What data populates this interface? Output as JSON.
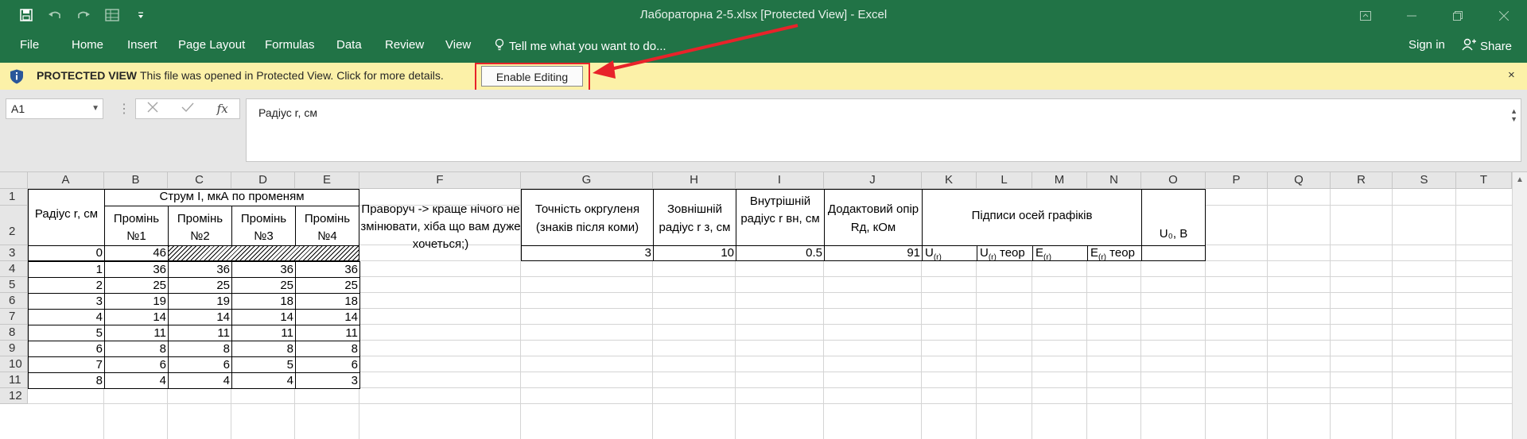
{
  "app": {
    "title": "Лабораторна 2-5.xlsx  [Protected View] - Excel",
    "quick_access": [
      "save-icon",
      "undo-icon",
      "redo-icon",
      "form-icon",
      "customize-icon"
    ]
  },
  "ribbon": {
    "tabs": [
      "File",
      "Home",
      "Insert",
      "Page Layout",
      "Formulas",
      "Data",
      "Review",
      "View"
    ],
    "tell_me": "Tell me what you want to do...",
    "sign_in": "Sign in",
    "share": "Share"
  },
  "protected_view": {
    "title": "PROTECTED VIEW",
    "message": "This file was opened in Protected View. Click for more details.",
    "enable_button": "Enable Editing",
    "close": "×",
    "accent": "#e8232a"
  },
  "formula_bar": {
    "name_box": "A1",
    "formula": "Радіус r, см",
    "fx": "fx"
  },
  "sheet": {
    "columns": [
      "A",
      "B",
      "C",
      "D",
      "E",
      "F",
      "G",
      "H",
      "I",
      "J",
      "K",
      "L",
      "M",
      "N",
      "O",
      "P",
      "Q",
      "R",
      "S",
      "T"
    ],
    "rows": [
      "1",
      "2",
      "3",
      "4",
      "5",
      "6",
      "7",
      "8",
      "9",
      "10",
      "11",
      "12"
    ],
    "headers": {
      "a": "Радіус r, см",
      "current": "Струм I, мкА по променям",
      "ray1": "Промінь №1",
      "ray2": "Промінь №2",
      "ray3": "Промінь №3",
      "ray4": "Промінь №4",
      "note": "Праворуч -> краще нічого не змінювати, хіба що вам дуже хочеться;)",
      "precision": "Точність окргуленя (знаків після коми)",
      "outer": "Зовнішній радіус r з, см",
      "inner": "Внутрішній радіус r вн, см",
      "extra": "Додактовий опір Rд, кОм",
      "axes": "Підписи осей графіків",
      "u0": "U₀, B"
    },
    "params": {
      "precision": "3",
      "outer": "10",
      "inner": "0.5",
      "extra": "91",
      "k": "U",
      "l": "U",
      "l_suffix": " теор",
      "m": "E",
      "n": "E",
      "n_suffix": " теор",
      "sub": "(r)"
    },
    "row3": {
      "a": "0",
      "b": "46"
    },
    "data_rows": [
      [
        "1",
        "36",
        "36",
        "36",
        "36"
      ],
      [
        "2",
        "25",
        "25",
        "25",
        "25"
      ],
      [
        "3",
        "19",
        "19",
        "18",
        "18"
      ],
      [
        "4",
        "14",
        "14",
        "14",
        "14"
      ],
      [
        "5",
        "11",
        "11",
        "11",
        "11"
      ],
      [
        "6",
        "8",
        "8",
        "8",
        "8"
      ],
      [
        "7",
        "6",
        "6",
        "5",
        "6"
      ],
      [
        "8",
        "4",
        "4",
        "4",
        "3"
      ]
    ]
  }
}
